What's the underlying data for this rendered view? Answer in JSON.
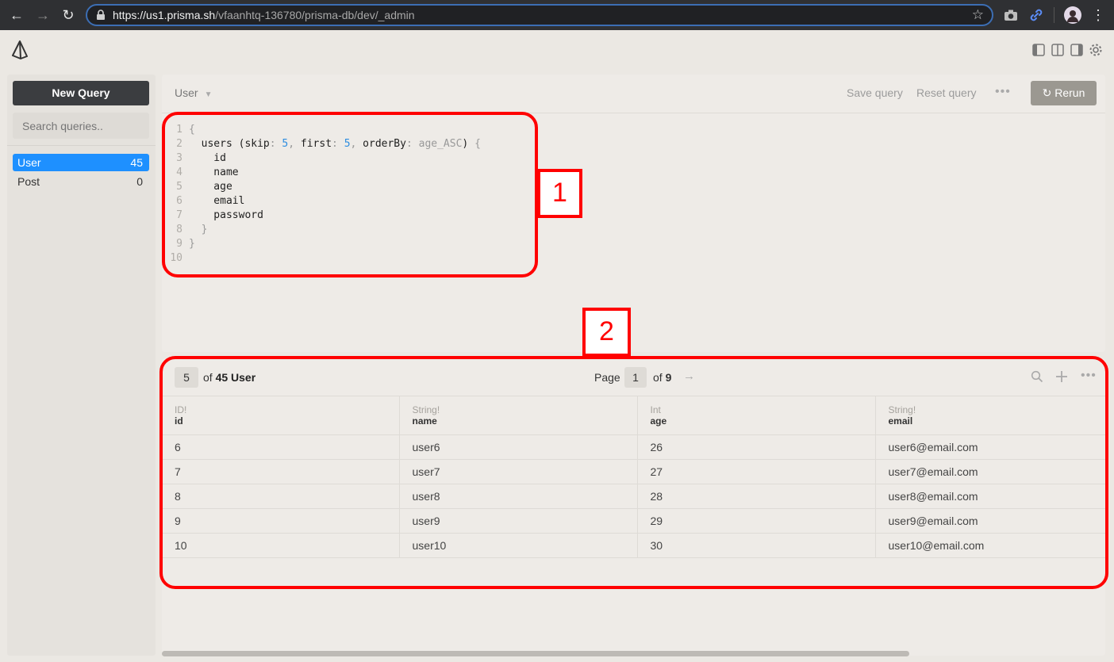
{
  "browser": {
    "url_scheme": "https://",
    "url_host": "us1.prisma.sh",
    "url_path": "/vfaanhtq-136780/prisma-db/dev/_admin",
    "back_icon": "back-arrow-icon",
    "forward_icon": "forward-arrow-icon",
    "reload_icon": "reload-icon"
  },
  "sidebar": {
    "new_query_label": "New Query",
    "search_placeholder": "Search queries..",
    "models": [
      {
        "name": "User",
        "count": "45",
        "active": true
      },
      {
        "name": "Post",
        "count": "0",
        "active": false
      }
    ]
  },
  "query_panel": {
    "model": "User",
    "save_label": "Save query",
    "reset_label": "Reset query",
    "more_label": "•••",
    "rerun_label": "Rerun",
    "code_lines": [
      {
        "n": "1",
        "text": "{"
      },
      {
        "n": "2",
        "text": "  users (skip: 5, first: 5, orderBy: age_ASC) {"
      },
      {
        "n": "3",
        "text": "    id"
      },
      {
        "n": "4",
        "text": "    name"
      },
      {
        "n": "5",
        "text": "    age"
      },
      {
        "n": "6",
        "text": "    email"
      },
      {
        "n": "7",
        "text": "    password"
      },
      {
        "n": "8",
        "text": "  }"
      },
      {
        "n": "9",
        "text": "}"
      },
      {
        "n": "10",
        "text": ""
      }
    ]
  },
  "results": {
    "count": "5",
    "of_prefix": "of",
    "total": "45 User",
    "page_label": "Page",
    "page": "1",
    "of_pages_prefix": "of",
    "pages": "9",
    "columns": [
      {
        "type": "ID!",
        "name": "id"
      },
      {
        "type": "String!",
        "name": "name"
      },
      {
        "type": "Int",
        "name": "age"
      },
      {
        "type": "String!",
        "name": "email"
      }
    ],
    "rows": [
      [
        "6",
        "user6",
        "26",
        "user6@email.com"
      ],
      [
        "7",
        "user7",
        "27",
        "user7@email.com"
      ],
      [
        "8",
        "user8",
        "28",
        "user8@email.com"
      ],
      [
        "9",
        "user9",
        "29",
        "user9@email.com"
      ],
      [
        "10",
        "user10",
        "30",
        "user10@email.com"
      ]
    ]
  },
  "annotations": [
    "1",
    "2"
  ],
  "colors": {
    "accent": "#1e90ff",
    "annotation": "#ff0000",
    "number_token": "#2d8de0"
  }
}
